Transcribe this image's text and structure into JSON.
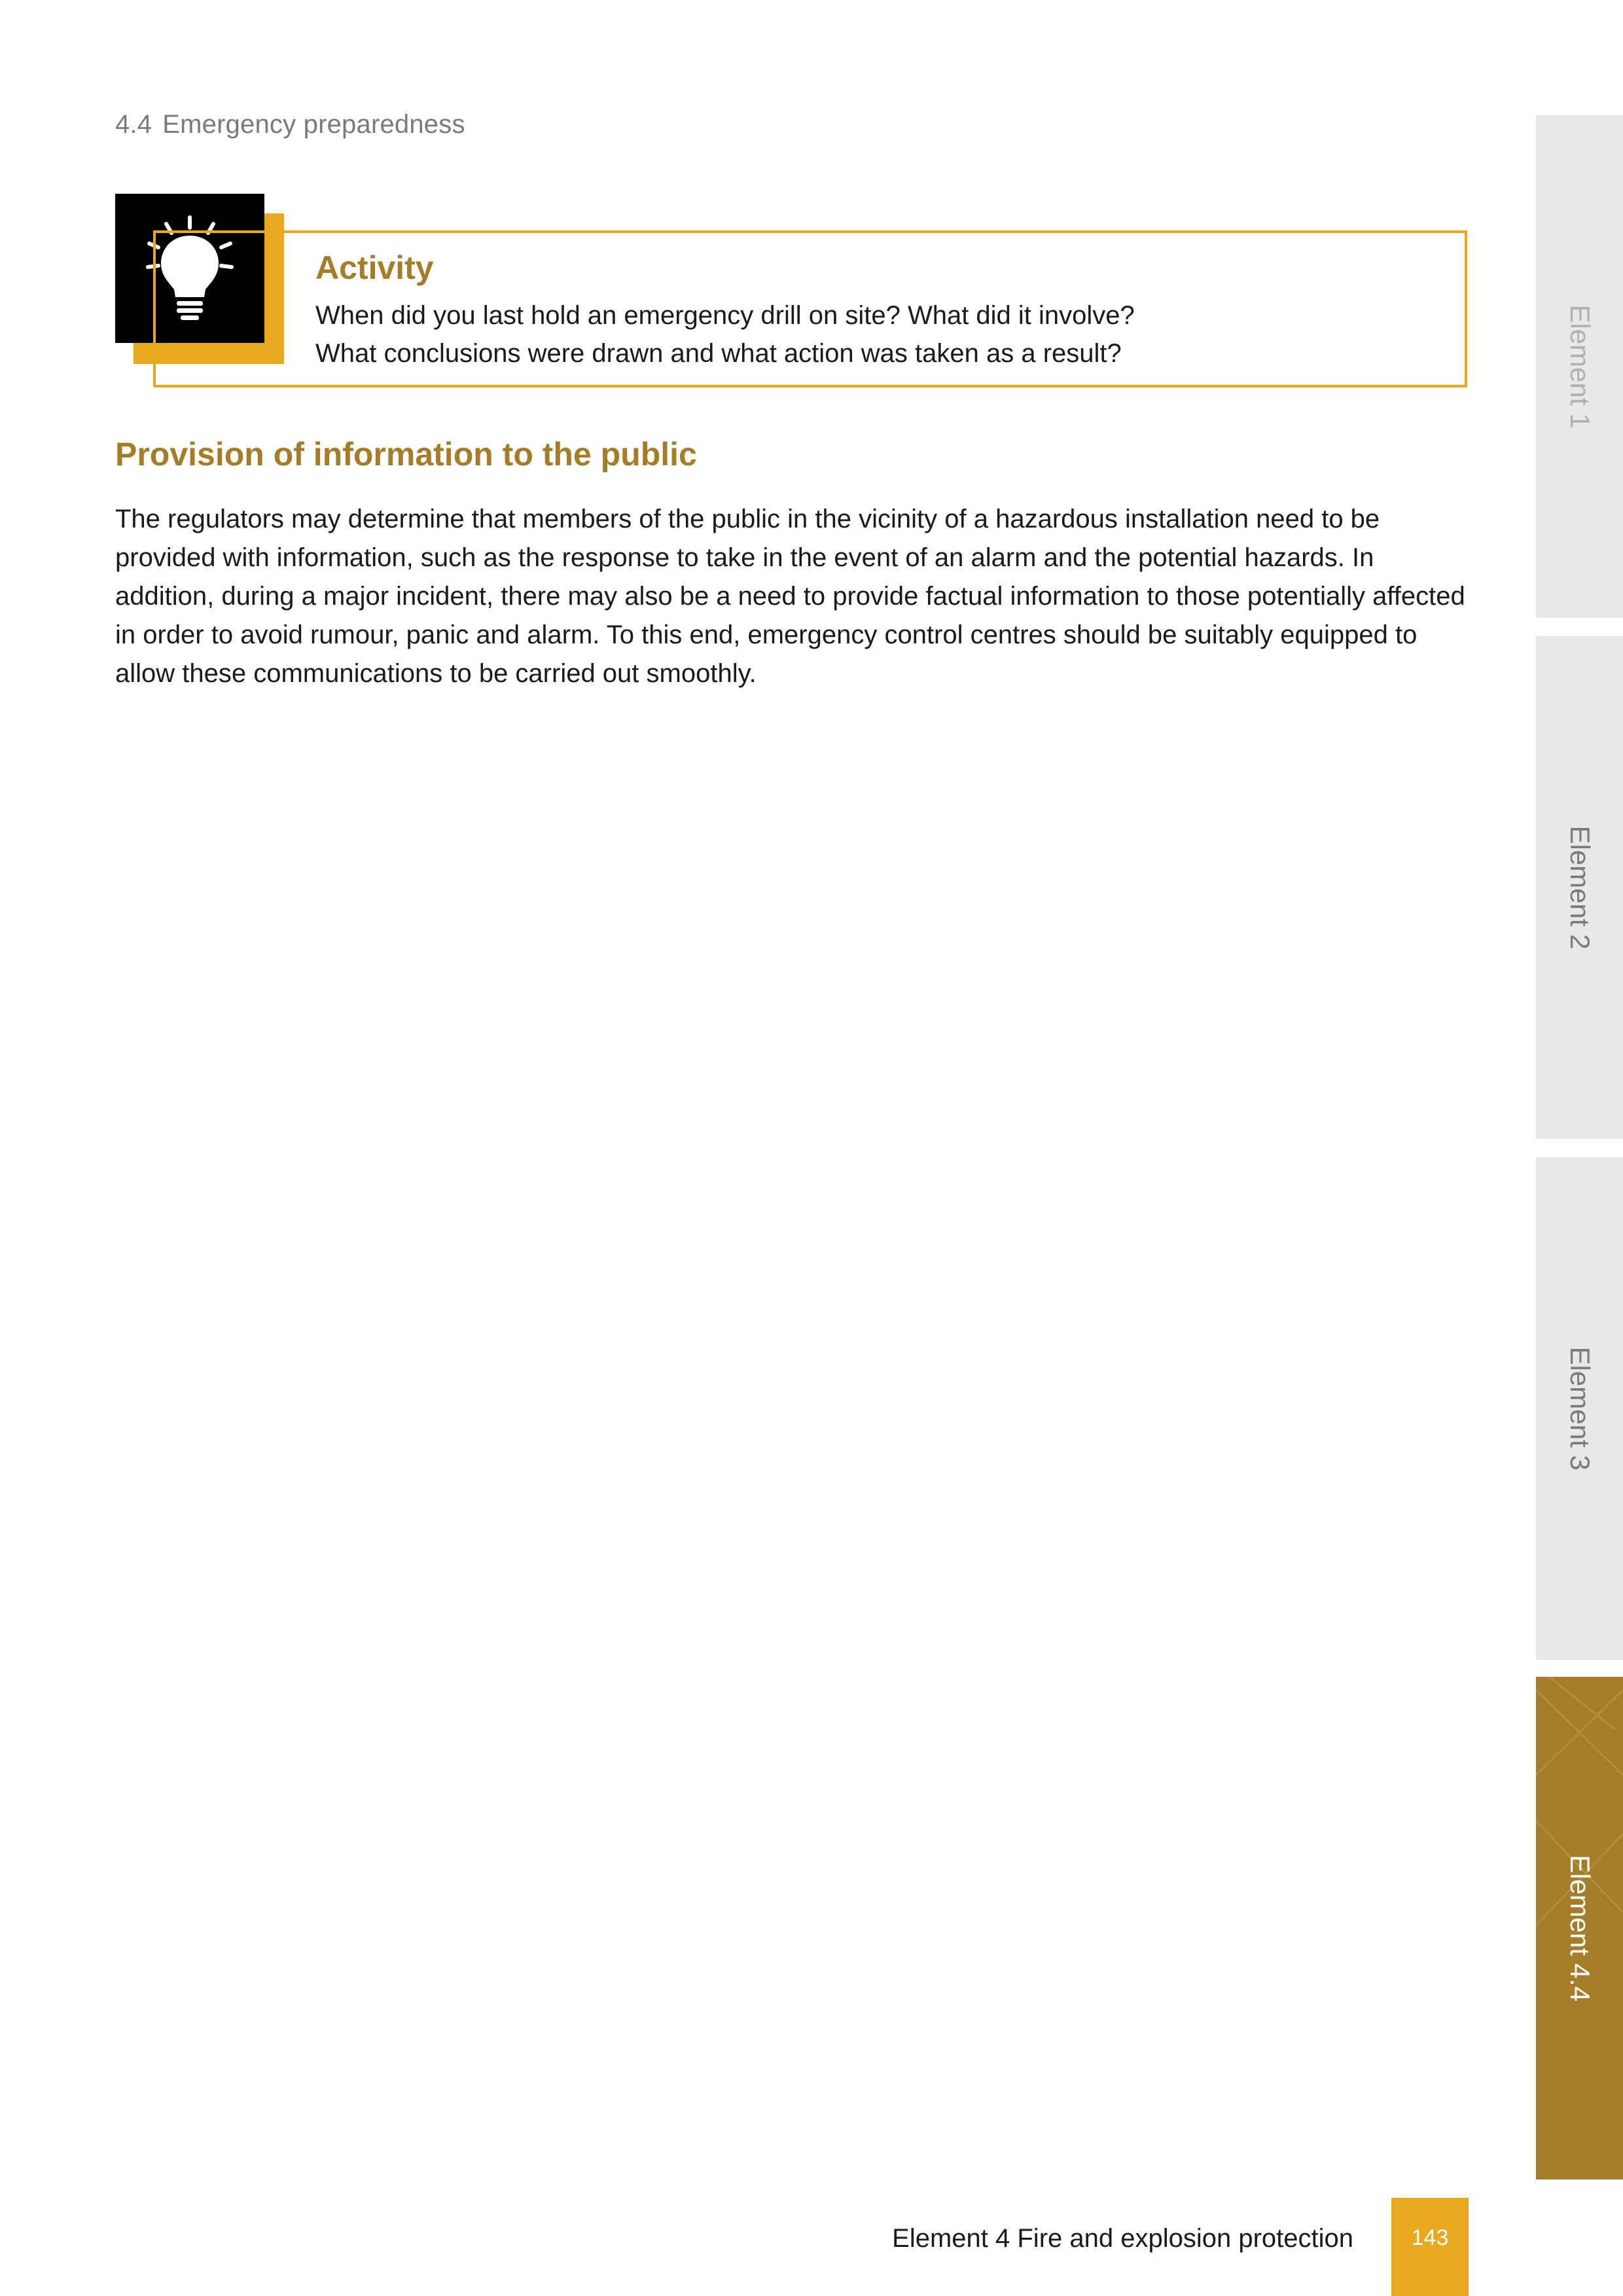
{
  "running_head": {
    "number": "4.4",
    "title": "Emergency preparedness"
  },
  "activity": {
    "icon": "lightbulb-icon",
    "title": "Activity",
    "lines": [
      "When did you last hold an emergency drill on site? What did it involve?",
      "What conclusions were drawn and what action was taken as a result?"
    ]
  },
  "section": {
    "heading": "Provision of information to the public",
    "paragraph": "The regulators may determine that members of the public in the vicinity of a hazardous installation need to be provided with information, such as the response to take in the event of an alarm and the potential hazards. In addition, during a major incident, there may also be a need to provide factual information to those potentially affected in order to avoid rumour, panic and alarm. To this end, emergency control centres should be suitably equipped to allow these communications to be carried out smoothly."
  },
  "side_tabs": [
    {
      "label": "Element 1",
      "active": false
    },
    {
      "label": "Element 2",
      "active": false
    },
    {
      "label": "Element 3",
      "active": false
    },
    {
      "label": "Element 4.4",
      "active": true
    }
  ],
  "footer": {
    "title": "Element 4 Fire and explosion protection",
    "page_number": "143"
  },
  "colors": {
    "accent_gold": "#a57c27",
    "accent_yellow": "#e8a820",
    "tab_grey": "#e8e8e8"
  }
}
